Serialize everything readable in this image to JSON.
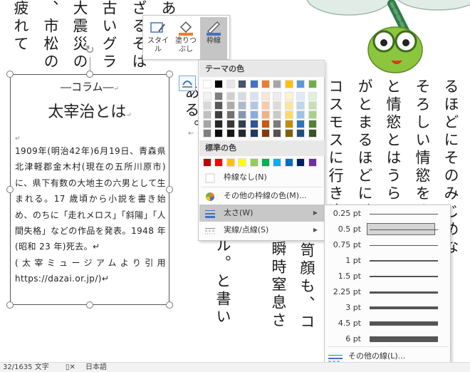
{
  "document": {
    "left_columns": [
      "疲れて",
      "、市松の",
      "大震災の",
      "古いグラ",
      "ざるそは",
      "ある"
    ],
    "mid_columns": [
      "ある。",
      "ル。と書い",
      "瞬時窒息さ",
      "笥顔も、コ"
    ],
    "right_columns": [
      "コスモスに行き逢うと",
      "がとまるほどに、苦し",
      "と情慾とはうらはらの",
      "そろしい情慾をさえ感",
      "るほどにそのみじめな"
    ]
  },
  "textbox": {
    "top_label": "―コラム―",
    "title": "太宰治とは",
    "para_mark": "↵",
    "body": "1909年(明治42年)6月19日、青森県北津軽郡金木村(現在の五所川原市)に、県下有数の大地主の六男として生まれる。17 歳頃から小説を書き始め、のちに「走れメロス」「斜陽」「人間失格」などの作品を発表。1948 年(昭和 23 年)死去。↵",
    "source": "(太宰ミュージアムより引用 https://dazai.or.jp/)↵"
  },
  "mini_toolbar": {
    "style_label": "スタイル",
    "fill_label": "塗りつぶし",
    "outline_label": "枠線"
  },
  "outline_menu": {
    "theme_header": "テーマの色",
    "standard_header": "標準の色",
    "no_outline": "枠線なし(N)",
    "more_colors": "その他の枠線の色(M)...",
    "weight": "太さ(W)",
    "dashes": "実線/点線(S)",
    "theme_colors": {
      "top": [
        "#ffffff",
        "#000000",
        "#e7e6e6",
        "#44546a",
        "#4472c4",
        "#ed7d31",
        "#a5a5a5",
        "#ffc000",
        "#5b9bd5",
        "#70ad47"
      ],
      "shade_rows": [
        [
          "#f2f2f2",
          "#7f7f7f",
          "#d0cece",
          "#d6dce4",
          "#d9e2f3",
          "#fbe5d5",
          "#ededed",
          "#fff2cc",
          "#deebf6",
          "#e2efd9"
        ],
        [
          "#d8d8d8",
          "#595959",
          "#aeabab",
          "#adb9ca",
          "#b4c6e7",
          "#f7cbac",
          "#dbdbdb",
          "#fee599",
          "#bdd7ee",
          "#c5e0b3"
        ],
        [
          "#bfbfbf",
          "#3f3f3f",
          "#757070",
          "#8496b0",
          "#8eaadb",
          "#f4b183",
          "#c9c9c9",
          "#ffd965",
          "#9cc3e5",
          "#a8d08d"
        ],
        [
          "#a5a5a5",
          "#262626",
          "#3a3838",
          "#323f4f",
          "#2f5496",
          "#c55a11",
          "#7b7b7b",
          "#bf8f00",
          "#2e75b5",
          "#538135"
        ],
        [
          "#7f7f7f",
          "#0c0c0c",
          "#171616",
          "#222a35",
          "#1f3864",
          "#833c0b",
          "#525252",
          "#7f6000",
          "#1f4e79",
          "#375623"
        ]
      ]
    },
    "standard_colors": [
      "#c00000",
      "#ff0000",
      "#ffc000",
      "#ffff00",
      "#92d050",
      "#00b050",
      "#00b0f0",
      "#0070c0",
      "#002060",
      "#7030a0"
    ]
  },
  "weight_submenu": {
    "items": [
      "0.25 pt",
      "0.5 pt",
      "0.75 pt",
      "1 pt",
      "1.5 pt",
      "2.25 pt",
      "3 pt",
      "4.5 pt",
      "6 pt"
    ],
    "selected": "0.5 pt",
    "more_lines": "その他の線(L)..."
  },
  "status_bar": {
    "word_count": "32/1635 文字",
    "language": "日本語"
  }
}
